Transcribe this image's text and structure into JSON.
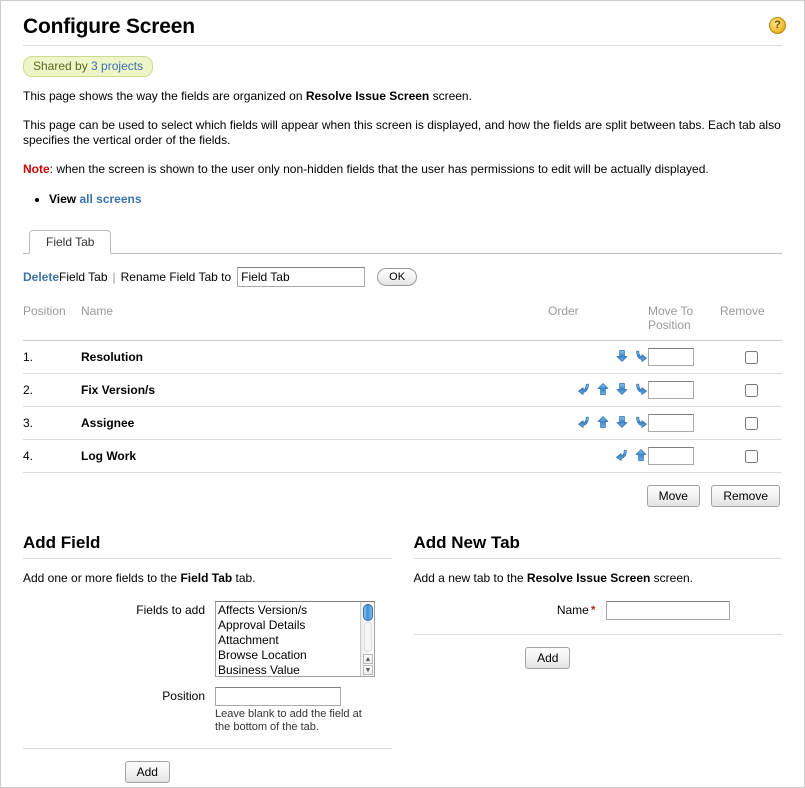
{
  "header": {
    "title": "Configure Screen",
    "help_icon": "help-question-icon",
    "help_glyph": "?",
    "badge_prefix": "Shared by",
    "badge_count": "3 projects"
  },
  "description": {
    "line1_a": "This page shows the way the fields are organized on ",
    "line1_b": "Resolve Issue Screen",
    "line1_c": " screen.",
    "line2": "This page can be used to select which fields will appear when this screen is displayed, and how the fields are split between tabs. Each tab also specifies the vertical order of the fields.",
    "note_label": "Note",
    "note_text": ": when the screen is shown to the user only non-hidden fields that the user has permissions to edit will be actually displayed.",
    "view_prefix": "View ",
    "view_link": "all screens"
  },
  "tab": {
    "label": "Field Tab"
  },
  "rename": {
    "delete_link": "Delete",
    "delete_rest": " Field Tab",
    "separator": "|",
    "rename_label": "Rename Field Tab to",
    "input_value": "Field Tab",
    "ok_label": "OK"
  },
  "table": {
    "headers": {
      "position": "Position",
      "name": "Name",
      "order": "Order",
      "move_to_position": "Move To Position",
      "remove": "Remove"
    },
    "rows": [
      {
        "position": "1.",
        "name": "Resolution",
        "icons": [
          "down",
          "bottom"
        ],
        "move_value": "",
        "removed": false
      },
      {
        "position": "2.",
        "name": "Fix Version/s",
        "icons": [
          "top",
          "up",
          "down",
          "bottom"
        ],
        "move_value": "",
        "removed": false
      },
      {
        "position": "3.",
        "name": "Assignee",
        "icons": [
          "top",
          "up",
          "down",
          "bottom"
        ],
        "move_value": "",
        "removed": false
      },
      {
        "position": "4.",
        "name": "Log Work",
        "icons": [
          "top",
          "up"
        ],
        "move_value": "",
        "removed": false
      }
    ],
    "move_button": "Move",
    "remove_button": "Remove"
  },
  "add_field": {
    "heading": "Add Field",
    "desc_a": "Add one or more fields to the ",
    "desc_b": "Field Tab",
    "desc_c": " tab.",
    "fields_label": "Fields to add",
    "options": [
      "Affects Version/s",
      "Approval Details",
      "Attachment",
      "Browse Location",
      "Business Value"
    ],
    "position_label": "Position",
    "position_value": "",
    "hint": "Leave blank to add the field at the bottom of the tab.",
    "add_button": "Add",
    "scroll_up_glyph": "▲",
    "scroll_down_glyph": "▼"
  },
  "add_tab": {
    "heading": "Add New Tab",
    "desc_a": "Add a new tab to the ",
    "desc_b": "Resolve Issue Screen",
    "desc_c": " screen.",
    "name_label": "Name",
    "required_mark": "*",
    "name_value": "",
    "add_button": "Add"
  },
  "colors": {
    "link": "#3b73af",
    "note": "#cc0000",
    "badge_bg": "#eef5c8",
    "badge_border": "#cdd98e",
    "arrow_blue": "#2f7fd0",
    "required": "#a63232"
  }
}
